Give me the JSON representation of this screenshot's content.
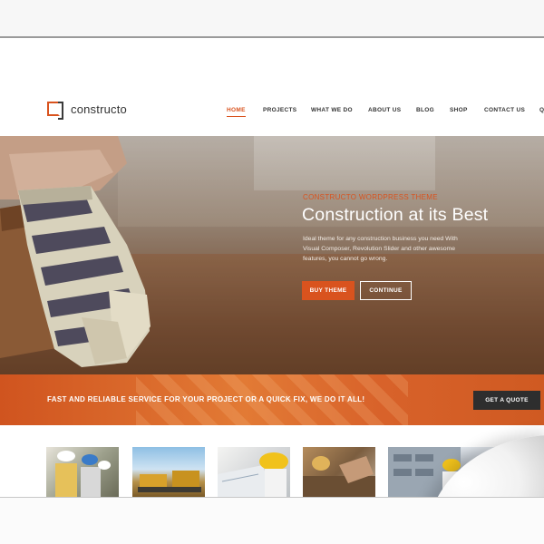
{
  "brand": {
    "name": "constructo"
  },
  "nav": {
    "items": [
      "HOME",
      "PROJECTS",
      "WHAT WE DO",
      "ABOUT US",
      "BLOG",
      "SHOP",
      "CONTACT US",
      "Q"
    ],
    "active": "HOME"
  },
  "hero": {
    "eyebrow": "CONSTRUCTO WORDPRESS THEME",
    "title": "Construction at its Best",
    "description": "Ideal theme for any construction business you need With Visual Composer, Revolution Slider and other awesome features, you cannot go wrong.",
    "buy_label": "BUY THEME",
    "continue_label": "CONTINUE"
  },
  "cta": {
    "text": "FAST AND RELIABLE SERVICE FOR YOUR PROJECT OR A QUICK FIX, WE DO IT ALL!",
    "button_label": "GET A QUOTE"
  },
  "colors": {
    "accent": "#d9531e",
    "dark_button": "#2e2e2e",
    "text_dark": "#333333"
  },
  "icons": [
    "logo-bracket-icon",
    "search-icon"
  ]
}
